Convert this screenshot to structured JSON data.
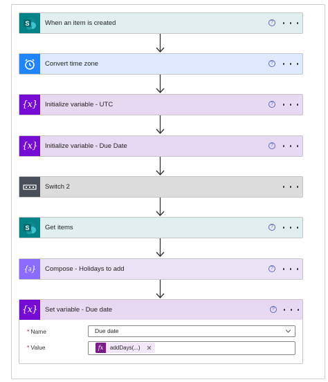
{
  "steps": [
    {
      "title": "When an item is created",
      "icon": "sharepoint-icon",
      "bg": "#e1eff0",
      "iconBg": "#038387"
    },
    {
      "title": "Convert time zone",
      "icon": "alarm-clock-icon",
      "bg": "#ddeaff",
      "iconBg": "#1f85ff"
    },
    {
      "title": "Initialize variable - UTC",
      "icon": "variable-icon",
      "bg": "#e7d9f1",
      "iconBg": "#770bd6"
    },
    {
      "title": "Initialize variable - Due Date",
      "icon": "variable-icon",
      "bg": "#e7d9f1",
      "iconBg": "#770bd6"
    },
    {
      "title": "Switch 2",
      "icon": "switch-icon",
      "bg": "#dcdcdc",
      "iconBg": "#484f58"
    },
    {
      "title": "Get items",
      "icon": "sharepoint-icon",
      "bg": "#e1eff0",
      "iconBg": "#038387"
    },
    {
      "title": "Compose - Holidays to add",
      "icon": "compose-icon",
      "bg": "#ebe3f5",
      "iconBg": "#8c6cff"
    }
  ],
  "set_variable": {
    "title": "Set variable - Due date",
    "icon": "variable-icon",
    "name_label": "Name",
    "name_value": "Due date",
    "value_label": "Value",
    "token_label": "addDays(...)",
    "fx_symbol": "fx",
    "required_mark": "*"
  },
  "help_symbol": "?"
}
